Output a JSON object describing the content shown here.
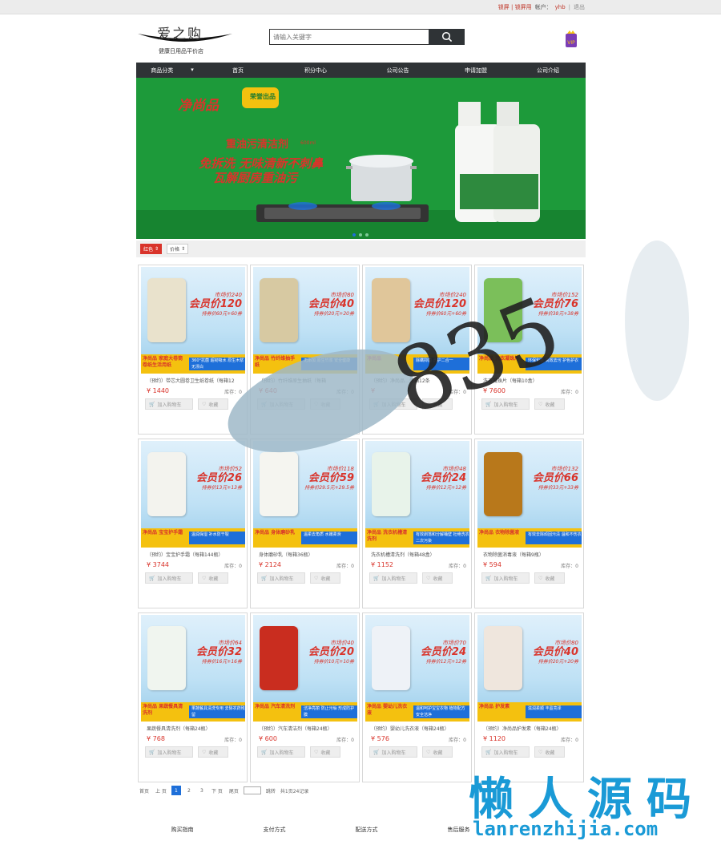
{
  "topbar": {
    "warning": "锁屏 | 锁屏用",
    "account_label": "帐户：",
    "username": "yhb",
    "logout": "退出"
  },
  "header": {
    "logo_title": "爱之购",
    "logo_subtitle": "健康日用品平价店",
    "search_placeholder": "请输入关键字"
  },
  "nav": {
    "category": "商品分类",
    "items": [
      "首页",
      "积分中心",
      "公司公告",
      "申请加盟",
      "公司介绍"
    ]
  },
  "banner": {
    "brand": "净尚品",
    "badge": "荣誉出品",
    "product": "重油污清洁剂",
    "volume": "600ml",
    "line1": "免拆洗 无味清新不刺鼻",
    "line2": "瓦解厨房重油污"
  },
  "sort": {
    "active": "红色",
    "price": "价格"
  },
  "common": {
    "currency": "¥",
    "stock_label": "库存：",
    "add_to_cart": "加入购物车",
    "favorite": "收藏",
    "market_prefix": "市场价",
    "member_prefix": "会员价"
  },
  "products": [
    {
      "name": "（预约）带芯大圆卷卫生纸卷纸（每箱12",
      "price": "1440",
      "stock": "0",
      "market": "240",
      "member": "120",
      "coupon": "持券价60元+60券",
      "brand": "净尚品 家庭大卷筒卷纸生活用纸",
      "slogan": "360°抗菌 超韧吸水 原生木浆无漂白",
      "color": "#e9e2cc"
    },
    {
      "name": "（预约）竹纤维原生抽纸（每箱",
      "price": "640",
      "stock": "0",
      "market": "80",
      "member": "40",
      "coupon": "持券价20元+20券",
      "brand": "净尚品 竹纤维抽手纸",
      "slogan": "无添加 原生竹浆 安全健康",
      "color": "#d7c9a2"
    },
    {
      "name": "（预约）净尚品…每箱12条",
      "price": "",
      "stock": "0",
      "market": "240",
      "member": "120",
      "coupon": "持券价60元+60券",
      "brand": "净尚品",
      "slogan": "除螨抑菌 洗护二合一",
      "color": "#e0c69a"
    },
    {
      "name": "洗衣凝珠片（每箱10盒）",
      "price": "7600",
      "stock": "0",
      "market": "152",
      "member": "76",
      "coupon": "持券价38元+38券",
      "brand": "净尚品 洗衣凝珠片",
      "slogan": "环保包装 高效去污 护色护衣",
      "color": "#7bbf5a"
    },
    {
      "name": "（预约）宝宝护手霜（每箱144瓶）",
      "price": "3744",
      "stock": "0",
      "market": "52",
      "member": "26",
      "coupon": "持券价13元+13券",
      "brand": "净尚品 宝宝护手霜",
      "slogan": "温润保湿 补水防干裂",
      "color": "#f3f3ee"
    },
    {
      "name": "身体磨砂乳（每箱36瓶）",
      "price": "2124",
      "stock": "0",
      "market": "118",
      "member": "59",
      "coupon": "持券价29.5元+29.5券",
      "brand": "净尚品 身体磨砂乳",
      "slogan": "温柔去角质 水嫩柔滑",
      "color": "#f5f5f0"
    },
    {
      "name": "洗衣机槽清洗剂（每箱48盒）",
      "price": "1152",
      "stock": "0",
      "market": "48",
      "member": "24",
      "coupon": "持券价12元+12券",
      "brand": "净尚品 洗衣机槽清洗剂",
      "slogan": "有效剥落和分解桶壁 杜绝洗衣二次污染",
      "color": "#e8f3ea"
    },
    {
      "name": "衣物除菌消毒液（每箱9瓶）",
      "price": "594",
      "stock": "0",
      "market": "132",
      "member": "66",
      "coupon": "持券价33元+33券",
      "brand": "净尚品 衣物除菌液",
      "slogan": "有效去除顽固污渍 温和不伤衣",
      "color": "#b8781b"
    },
    {
      "name": "果蔬餐具清洗剂（每箱24瓶）",
      "price": "768",
      "stock": "0",
      "market": "64",
      "member": "32",
      "coupon": "持券价16元+16券",
      "brand": "净尚品 果蔬餐具清洗剂",
      "slogan": "果蔬餐具清洗专用 去除农药残留",
      "color": "#f0f5ef"
    },
    {
      "name": "（预约）汽车清洁剂（每箱24瓶）",
      "price": "600",
      "stock": "0",
      "market": "40",
      "member": "20",
      "coupon": "持券价10元+10券",
      "brand": "净尚品 汽车清洗剂",
      "slogan": "洁净亮丽 防止污垢 形成防护膜",
      "color": "#c92d1f"
    },
    {
      "name": "（预约）婴幼儿洗衣液（每箱24瓶）",
      "price": "576",
      "stock": "0",
      "market": "70",
      "member": "24",
      "coupon": "持券价12元+12券",
      "brand": "净尚品 婴幼儿洗衣液",
      "slogan": "温和呵护宝宝衣物 植物配方 安全洁净",
      "color": "#eef2f7"
    },
    {
      "name": "（预约）净尚品护发素（每箱24瓶）",
      "price": "1120",
      "stock": "0",
      "market": "80",
      "member": "40",
      "coupon": "持券价20元+20券",
      "brand": "净尚品 护发素",
      "slogan": "滋润柔顺 丰盈亮泽",
      "color": "#efe6dd"
    }
  ],
  "pagination": {
    "first": "首页",
    "prev": "上 页",
    "pages": [
      "1",
      "2",
      "3"
    ],
    "next": "下 页",
    "last": "尾页",
    "go": "跳转",
    "total": "共1页24记录"
  },
  "footer": {
    "items": [
      "购买指南",
      "支付方式",
      "配送方式",
      "售后服务"
    ]
  },
  "watermark": {
    "big": "懒人源码",
    "url": "lanrenzhijia.com",
    "digits": "835"
  }
}
